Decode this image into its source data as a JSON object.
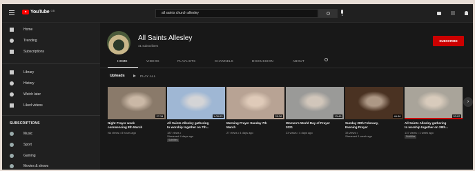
{
  "browser": {
    "search_query": "all saints church allesley"
  },
  "logo": {
    "wordmark": "YouTube",
    "country": "GB"
  },
  "sidebar": {
    "main_items": [
      {
        "label": "Home",
        "icon": "home-icon"
      },
      {
        "label": "Trending",
        "icon": "flame-icon"
      },
      {
        "label": "Subscriptions",
        "icon": "subscriptions-icon"
      }
    ],
    "library_items": [
      {
        "label": "Library",
        "icon": "library-icon"
      },
      {
        "label": "History",
        "icon": "history-icon"
      },
      {
        "label": "Watch later",
        "icon": "clock-icon"
      },
      {
        "label": "Liked videos",
        "icon": "thumbs-up-icon"
      }
    ],
    "subscriptions_header": "SUBSCRIPTIONS",
    "subscriptions": [
      {
        "label": "Music",
        "icon": "music-icon"
      },
      {
        "label": "Sport",
        "icon": "trophy-icon"
      },
      {
        "label": "Gaming",
        "icon": "gamepad-icon"
      },
      {
        "label": "Movies & shows",
        "icon": "film-icon"
      }
    ]
  },
  "channel": {
    "name": "All Saints Allesley",
    "subscribers": "41 subscribers",
    "subscribe_label": "SUBSCRIBE",
    "tabs": [
      "HOME",
      "VIDEOS",
      "PLAYLISTS",
      "CHANNELS",
      "DISCUSSION",
      "ABOUT"
    ],
    "active_tab": "HOME"
  },
  "uploads": {
    "heading": "Uploads",
    "play_all": "PLAY ALL",
    "videos": [
      {
        "title_line1": "Night Prayer week",
        "title_line2": "commencing 8th March",
        "meta1": "No views • 8 hours ago",
        "meta2": "",
        "badge": "",
        "duration": "27:34",
        "thumb_color": "#8a7a6a",
        "progress": 0
      },
      {
        "title_line1": "All Saints Allesley gathering",
        "title_line2": "to worship together on 7th...",
        "meta1": "187 views •",
        "meta2": "Streamed 4 days ago",
        "badge": "Subtitles",
        "duration": "1:00:03",
        "thumb_color": "#9fb7d4",
        "progress": 0
      },
      {
        "title_line1": "Morning Prayer Sunday 7th",
        "title_line2": "March",
        "meta1": "27 views • 4 days ago",
        "meta2": "",
        "badge": "",
        "duration": "20:36",
        "thumb_color": "#b8a394",
        "progress": 0
      },
      {
        "title_line1": "Women's World Day of Prayer",
        "title_line2": "2021",
        "meta1": "23 views • 4 days ago",
        "meta2": "",
        "badge": "",
        "duration": "13:49",
        "thumb_color": "#9a9a98",
        "progress": 0
      },
      {
        "title_line1": "Sunday 28th February,",
        "title_line2": "Evening Prayer",
        "meta1": "33 views •",
        "meta2": "Streamed 1 week ago",
        "badge": "",
        "duration": "46:36",
        "thumb_color": "#4a3222",
        "progress": 0
      },
      {
        "title_line1": "All Saints Allesley gathering",
        "title_line2": "to worship together on 28th...",
        "meta1": "137 views • 1 week ago",
        "meta2": "",
        "badge": "Subtitles",
        "duration": "53:02",
        "thumb_color": "#a9a49a",
        "progress": 1
      }
    ]
  }
}
